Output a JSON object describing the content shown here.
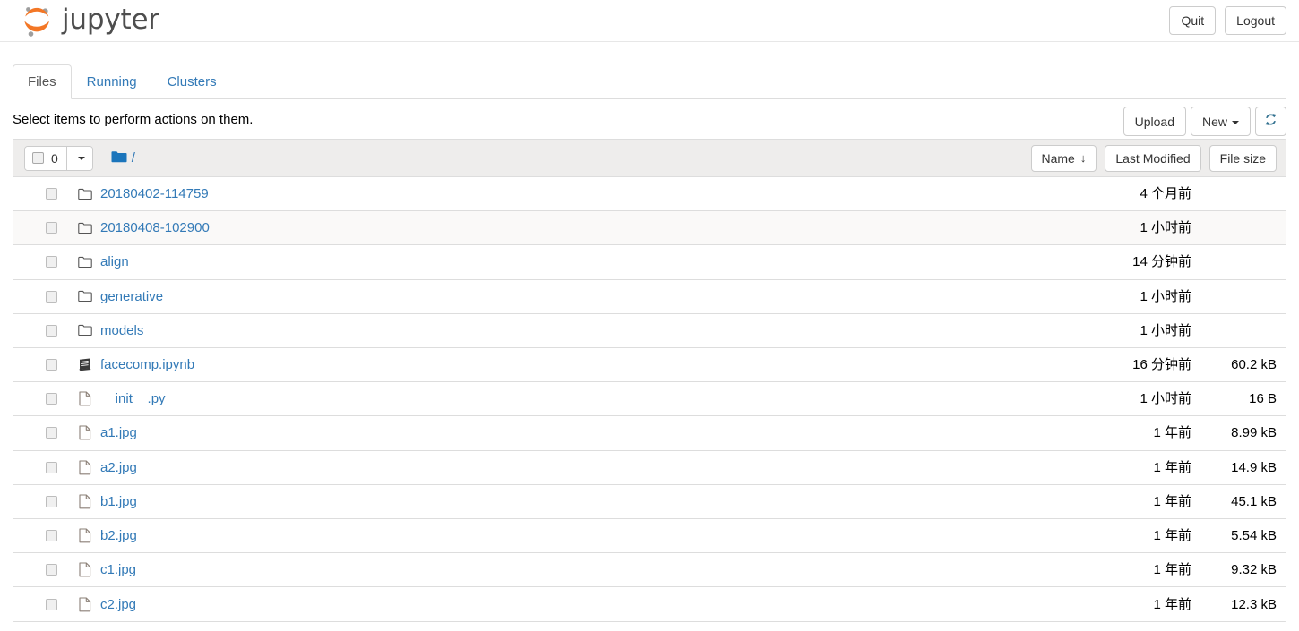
{
  "header": {
    "brand": "jupyter",
    "logo_icon": "jupyter-logo-icon",
    "quit_label": "Quit",
    "logout_label": "Logout"
  },
  "tabs": [
    {
      "label": "Files",
      "active": true
    },
    {
      "label": "Running",
      "active": false
    },
    {
      "label": "Clusters",
      "active": false
    }
  ],
  "actionbar": {
    "message": "Select items to perform actions on them.",
    "upload_label": "Upload",
    "new_label": "New",
    "refresh_icon": "refresh-icon"
  },
  "list_header": {
    "selected_count": "0",
    "folder_icon": "folder-icon",
    "breadcrumb_root": "/",
    "sort_name": "Name",
    "sort_name_arrow": "↓",
    "sort_modified": "Last Modified",
    "sort_size": "File size"
  },
  "colors": {
    "link": "#337ab7",
    "brand_orange": "#f37726",
    "brand_gray": "#9e9e9e",
    "header_bg": "#eeedec",
    "border": "#dddddd",
    "folder_blue": "#1b75bb"
  },
  "files": [
    {
      "name": "20180402-114759",
      "type": "folder",
      "modified": "4 个月前",
      "size": "",
      "alt": false
    },
    {
      "name": "20180408-102900",
      "type": "folder",
      "modified": "1 小时前",
      "size": "",
      "alt": true
    },
    {
      "name": "align",
      "type": "folder",
      "modified": "14 分钟前",
      "size": "",
      "alt": false
    },
    {
      "name": "generative",
      "type": "folder",
      "modified": "1 小时前",
      "size": "",
      "alt": false
    },
    {
      "name": "models",
      "type": "folder",
      "modified": "1 小时前",
      "size": "",
      "alt": false
    },
    {
      "name": "facecomp.ipynb",
      "type": "notebook",
      "modified": "16 分钟前",
      "size": "60.2 kB",
      "alt": false
    },
    {
      "name": "__init__.py",
      "type": "file",
      "modified": "1 小时前",
      "size": "16 B",
      "alt": false
    },
    {
      "name": "a1.jpg",
      "type": "file",
      "modified": "1 年前",
      "size": "8.99 kB",
      "alt": false
    },
    {
      "name": "a2.jpg",
      "type": "file",
      "modified": "1 年前",
      "size": "14.9 kB",
      "alt": false
    },
    {
      "name": "b1.jpg",
      "type": "file",
      "modified": "1 年前",
      "size": "45.1 kB",
      "alt": false
    },
    {
      "name": "b2.jpg",
      "type": "file",
      "modified": "1 年前",
      "size": "5.54 kB",
      "alt": false
    },
    {
      "name": "c1.jpg",
      "type": "file",
      "modified": "1 年前",
      "size": "9.32 kB",
      "alt": false
    },
    {
      "name": "c2.jpg",
      "type": "file",
      "modified": "1 年前",
      "size": "12.3 kB",
      "alt": false
    }
  ]
}
